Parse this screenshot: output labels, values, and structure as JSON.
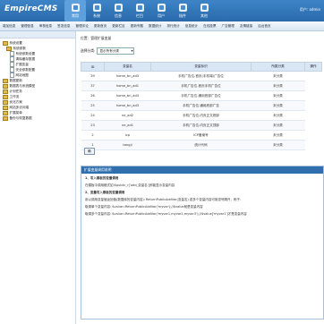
{
  "header": {
    "logo_main": "EmpireCMS",
    "logo_sub": "",
    "user_text": "用户: admin",
    "tabs": [
      {
        "label": "常用",
        "active": true
      },
      {
        "label": "系统",
        "active": false
      },
      {
        "label": "信息",
        "active": false
      },
      {
        "label": "栏目",
        "active": false
      },
      {
        "label": "用户",
        "active": false
      },
      {
        "label": "插件",
        "active": false
      },
      {
        "label": "其他",
        "active": false
      }
    ]
  },
  "menubar": [
    "增加信息",
    "管理信息",
    "审核信息",
    "签发信息",
    "管理评论",
    "更新首页",
    "更新栏目",
    "更新专题",
    "数据统计",
    "排行统计",
    "信息统计",
    "在线投票",
    "广告管理",
    "友情链接",
    "后台首页"
  ],
  "sidebar": {
    "nodes": [
      {
        "level": 0,
        "type": "folder",
        "label": "系统设置"
      },
      {
        "level": 1,
        "type": "folder",
        "label": "系统参数"
      },
      {
        "level": 2,
        "type": "doc",
        "label": "系统参数设置"
      },
      {
        "level": 2,
        "type": "doc",
        "label": "清除缓存数据"
      },
      {
        "level": 2,
        "type": "doc",
        "label": "扩展变量"
      },
      {
        "level": 2,
        "type": "doc",
        "label": "安全参数配置"
      },
      {
        "level": 2,
        "type": "doc",
        "label": "网站地图"
      },
      {
        "level": 0,
        "type": "folder",
        "label": "数据更新"
      },
      {
        "level": 0,
        "type": "folder",
        "label": "数据表与系统模型"
      },
      {
        "level": 0,
        "type": "folder",
        "label": "计划任务"
      },
      {
        "level": 0,
        "type": "folder",
        "label": "工作流"
      },
      {
        "level": 0,
        "type": "folder",
        "label": "优化方案"
      },
      {
        "level": 0,
        "type": "folder",
        "label": "网站多访问端"
      },
      {
        "level": 0,
        "type": "folder",
        "label": "扩展菜单"
      },
      {
        "level": 0,
        "type": "folder",
        "label": "备份与恢复数据"
      }
    ]
  },
  "main": {
    "breadcrumb": "位置：管理扩展变量",
    "select_label": "选择分类:",
    "select_value": "显示所有分类",
    "columns": [
      "ID",
      "变量名",
      "变量标识",
      "所属分类",
      "操作"
    ],
    "rows": [
      {
        "id": "39",
        "name": "home_bn_ad3",
        "label": "手机广告位-首页(手机端)广告位",
        "cat": "未分类"
      },
      {
        "id": "37",
        "name": "home_bn_ad1",
        "label": "手机广告位-首页手机广告位",
        "cat": "未分类"
      },
      {
        "id": "26",
        "name": "home_bn_ad3",
        "label": "手机广告位-通用底部广告位",
        "cat": "未分类"
      },
      {
        "id": "25",
        "name": "home_bn_ad3",
        "label": "手机广告位-通用底部广告",
        "cat": "未分类"
      },
      {
        "id": "24",
        "name": "ne_ad2",
        "label": "手机广告位-内页正文底部",
        "cat": "未分类"
      },
      {
        "id": "23",
        "name": "ne_ad1",
        "label": "手机广告位-内页正文顶部",
        "cat": "未分类"
      },
      {
        "id": "2",
        "name": "icp",
        "label": "ICP备案号",
        "cat": "未分类"
      },
      {
        "id": "1",
        "name": "tongji",
        "label": "统计代码",
        "cat": "未分类"
      }
    ],
    "ok_button": "确",
    "panel": {
      "title": "扩展变量调用说明",
      "sec1_title": "1、写入模板的变量调用",
      "sec1_body": "在模板中调用格式如:$public_r['add_变量名']即能显示变量内容",
      "sec2_title": "2、变量写入模板的变量调用",
      "sec2_lines": [
        "用以调用变量值返回值(数据库的变量内容): ReturnPublicAddVar(变量名) 若多个变量内容可用逗号隔开，例子:",
        "取调单个变量内容: $value=ReturnPublicAddVar('myvar');//$value就是变量内容",
        "取调多个变量内容: $value=ReturnPublicAddVar('myvar1,myvar2,myvar3');//$value['myvar1']才是变量内容"
      ]
    }
  },
  "colors": {
    "header": "#2a6aab",
    "panel_head": "#2f6fae",
    "table_head": "#d9e6f3"
  }
}
